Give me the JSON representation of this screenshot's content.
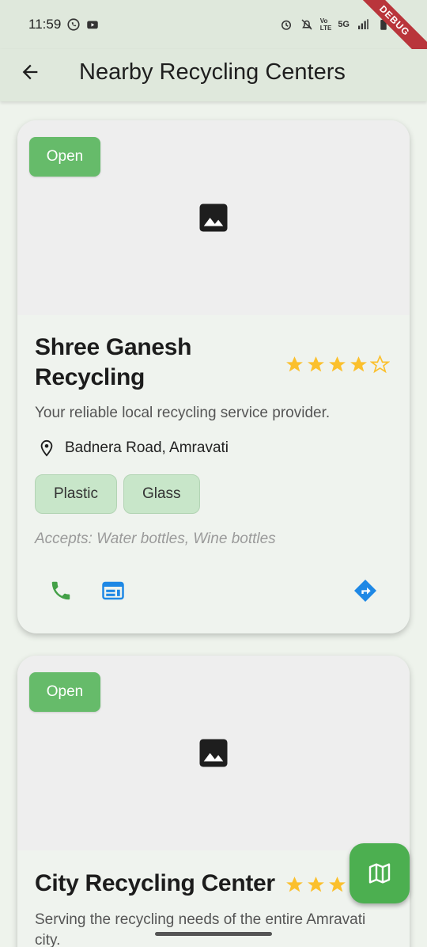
{
  "status_bar": {
    "time": "11:59",
    "network": "5G",
    "volte": "Vo\nLTE",
    "left_icons": [
      "whatsapp-icon",
      "youtube-icon"
    ],
    "right_icons": [
      "alarm-icon",
      "mute-icon",
      "signal-icon",
      "battery-icon"
    ]
  },
  "debug_banner": "DEBUG",
  "app_bar": {
    "title": "Nearby Recycling Centers",
    "back_icon": "arrow-back-icon"
  },
  "colors": {
    "accent": "#4caf50",
    "open_badge": "#66bb6a",
    "chip_bg": "#c8e6c9",
    "star": "#fbc02d",
    "link_blue": "#1e88e5"
  },
  "centers": [
    {
      "status": "Open",
      "name": "Shree Ganesh Recycling",
      "rating": 4,
      "rating_max": 5,
      "description": "Your reliable local recycling service provider.",
      "address": "Badnera Road, Amravati",
      "materials": [
        "Plastic",
        "Glass"
      ],
      "accepts": "Accepts: Water bottles, Wine bottles",
      "actions": [
        "phone-icon",
        "web-icon",
        "directions-icon"
      ]
    },
    {
      "status": "Open",
      "name": "City Recycling Center",
      "rating": 3,
      "rating_max": 5,
      "description": "Serving the recycling needs of the entire Amravati city."
    }
  ],
  "fab": {
    "icon": "map-icon"
  }
}
